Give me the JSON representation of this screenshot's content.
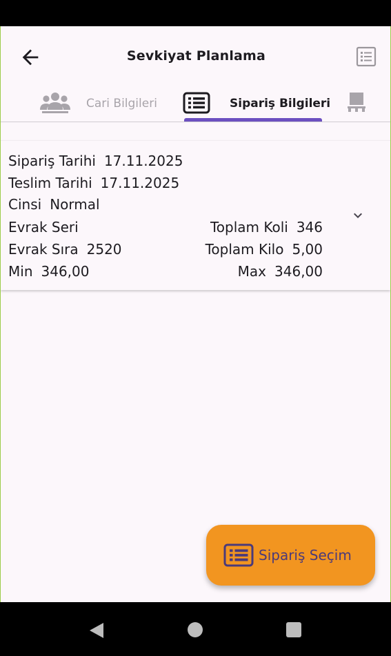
{
  "app_bar": {
    "title": "Sevkiyat Planlama"
  },
  "tabs": [
    {
      "label": "Cari Bilgileri",
      "icon": "people-group-icon",
      "color": "#a8a4aa",
      "selected": false
    },
    {
      "label": "Sipariş Bilgileri",
      "icon": "list-box-icon",
      "color": "#1d1b20",
      "selected": true
    },
    {
      "label": "",
      "icon": "pallet-icon",
      "color": "#a8a4aa",
      "selected": false
    }
  ],
  "order_card": {
    "siparis_tarihi": {
      "label": "Sipariş Tarihi",
      "value": "17.11.2025"
    },
    "teslim_tarihi": {
      "label": "Teslim Tarihi",
      "value": "17.11.2025"
    },
    "cinsi": {
      "label": "Cinsi",
      "value": "Normal"
    },
    "evrak_seri": {
      "label": "Evrak Seri",
      "value": ""
    },
    "toplam_koli": {
      "label": "Toplam Koli",
      "value": "346"
    },
    "evrak_sira": {
      "label": "Evrak Sıra",
      "value": "2520"
    },
    "toplam_kilo": {
      "label": "Toplam Kilo",
      "value": "5,00"
    },
    "min": {
      "label": "Min",
      "value": "346,00"
    },
    "max": {
      "label": "Max",
      "value": "346,00"
    }
  },
  "fab": {
    "label": "Sipariş Seçim",
    "background": "#f29520",
    "text_color": "#4b3a7a"
  },
  "colors": {
    "accent": "#6c4fc0",
    "surface": "#fcf7fb"
  }
}
